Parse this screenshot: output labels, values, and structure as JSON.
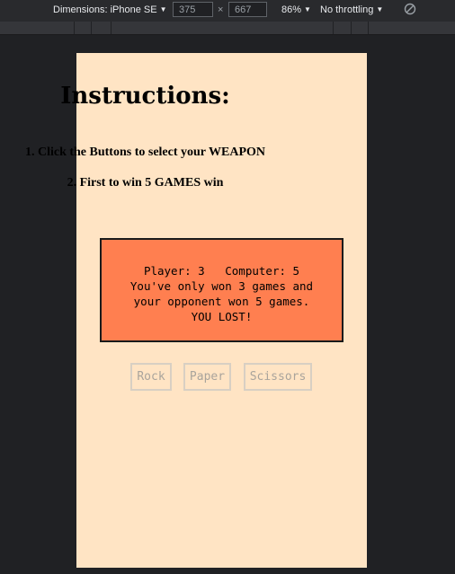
{
  "devtools": {
    "dimensions_label": "Dimensions: iPhone SE",
    "width": "375",
    "height": "667",
    "times_sign": "×",
    "zoom": "86%",
    "throttling": "No throttling"
  },
  "page": {
    "title": "Instructions:",
    "step1": "1. Click the Buttons to select your WEAPON",
    "step2": "2. First to win 5 GAMES win",
    "result": {
      "score_line": "Player: 3   Computer: 5",
      "message_line1": "You've only won 3 games and",
      "message_line2": "your opponent won 5 games.",
      "outcome": "YOU LOST!"
    },
    "buttons": {
      "rock": "Rock",
      "paper": "Paper",
      "scissors": "Scissors"
    }
  },
  "colors": {
    "page_background": "#ffe4c4",
    "result_background": "#ff7f50",
    "devtools_background": "#292a2d"
  }
}
